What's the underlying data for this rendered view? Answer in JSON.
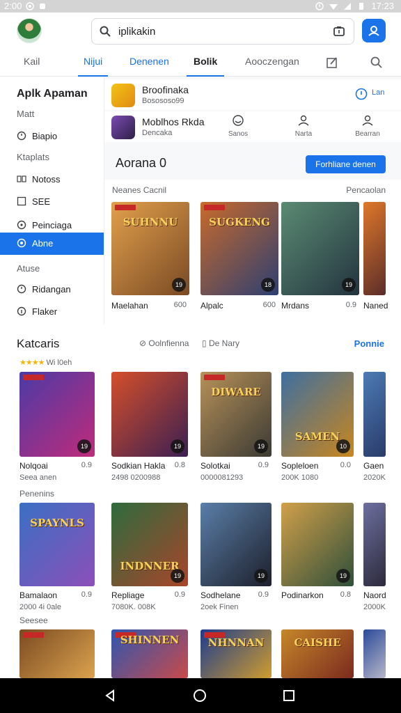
{
  "status": {
    "time_left": "2:00",
    "time_right": "17:23"
  },
  "search": {
    "query": "iplikakin"
  },
  "tabs": [
    "Kail",
    "Nijui",
    "Denenen",
    "Bolik",
    "Aooczengan"
  ],
  "sidebar": {
    "header": "Aplk Apaman",
    "items": [
      "Matt",
      "Biapio",
      "Ktaplats",
      "Notoss",
      "SEE",
      "Peinciaga",
      "Abne",
      "Atuse",
      "Ridangan",
      "Flaker"
    ]
  },
  "top_apps": [
    {
      "name": "Broofinaka",
      "sub": "Bosososo99",
      "icon_color": "#f3c316"
    },
    {
      "name": "Moblhos Rkda",
      "sub": "Dencaka",
      "icon_color": "#7b4bb2"
    }
  ],
  "mini_actions": [
    "Sanos",
    "Narta",
    "Bearran"
  ],
  "featured": {
    "title": "Aorana 0",
    "button": "Forhliane denen",
    "left_label": "Neanes Cacnil",
    "right_label": "Pencaolan",
    "cards": [
      {
        "title": "SUHNNU",
        "name": "Maelahan",
        "rate": "600",
        "badge": "19",
        "c1": "#e2a04c",
        "c2": "#7a4a24"
      },
      {
        "title": "SUGKENG",
        "name": "Alpalc",
        "rate": "600",
        "badge": "18",
        "c1": "#c96a2b",
        "c2": "#2d3f72"
      },
      {
        "title": "",
        "name": "Mrdans",
        "rate": "0.9",
        "badge": "19",
        "c1": "#5b8b73",
        "c2": "#23333f"
      },
      {
        "title": "",
        "name": "Naned",
        "rate": "",
        "badge": "",
        "c1": "#e0782a",
        "c2": "#5a2d2a"
      }
    ]
  },
  "section2": {
    "title": "Katcaris",
    "chip1": "Oolnfienna",
    "chip2": "De Nary",
    "more": "Ponnie",
    "stars_text": "Wi l0eh",
    "label_row2": "Penenins",
    "label_row3": "Seesee",
    "row1": [
      {
        "name": "Nolqoai",
        "rate": "0.9",
        "sub": "Seea anen",
        "badge": "19",
        "title": "",
        "c1": "#4b3aa6",
        "c2": "#c02b7a"
      },
      {
        "name": "Sodkian Hakla",
        "rate": "0.8",
        "sub": "2498 0200988",
        "badge": "19",
        "title": "",
        "c1": "#d54f2a",
        "c2": "#3b1f52"
      },
      {
        "name": "Solotkai",
        "rate": "0.9",
        "sub": "0000081293",
        "badge": "19",
        "title": "DIWARE",
        "c1": "#b79159",
        "c2": "#3b3a34"
      },
      {
        "name": "Sopleloen",
        "rate": "0.0",
        "sub": "200K 1080",
        "badge": "10",
        "title": "SAMEN",
        "c1": "#3e6fa1",
        "c2": "#c8861e"
      },
      {
        "name": "Gaen",
        "rate": "",
        "sub": "2020K",
        "badge": "",
        "title": "",
        "c1": "#4c7bb5",
        "c2": "#2a3b68"
      }
    ],
    "row2": [
      {
        "name": "Bamalaon",
        "rate": "0.9",
        "sub": "2000 4i 0ale",
        "badge": "",
        "title": "SPAYNLS",
        "c1": "#3b6fc4",
        "c2": "#8c4fb8"
      },
      {
        "name": "Repliage",
        "rate": "0.9",
        "sub": "7080K. 008K",
        "badge": "19",
        "title": "INDNNER",
        "c1": "#2e6b3d",
        "c2": "#a8452b"
      },
      {
        "name": "Sodhelane",
        "rate": "0.9",
        "sub": "2oek Finen",
        "badge": "19",
        "title": "",
        "c1": "#5a7fa8",
        "c2": "#1d1f2b"
      },
      {
        "name": "Podinarkon",
        "rate": "0.8",
        "sub": "",
        "badge": "19",
        "title": "",
        "c1": "#d1a04a",
        "c2": "#2f4f3a"
      },
      {
        "name": "Naord",
        "rate": "",
        "sub": "2000K",
        "badge": "",
        "title": "",
        "c1": "#6d6fa0",
        "c2": "#2c2a3a"
      }
    ],
    "row3": [
      {
        "title": "",
        "c1": "#7b4a22",
        "c2": "#dba34e"
      },
      {
        "title": "SHINNEN",
        "c1": "#2e56b0",
        "c2": "#c94a4a"
      },
      {
        "title": "NHNNAN",
        "c1": "#1d3c8c",
        "c2": "#d09c2e"
      },
      {
        "title": "CAISHE",
        "c1": "#c5872a",
        "c2": "#7b2a1e"
      },
      {
        "title": "",
        "c1": "#2c4a9a",
        "c2": "#b6b6c8"
      }
    ]
  }
}
